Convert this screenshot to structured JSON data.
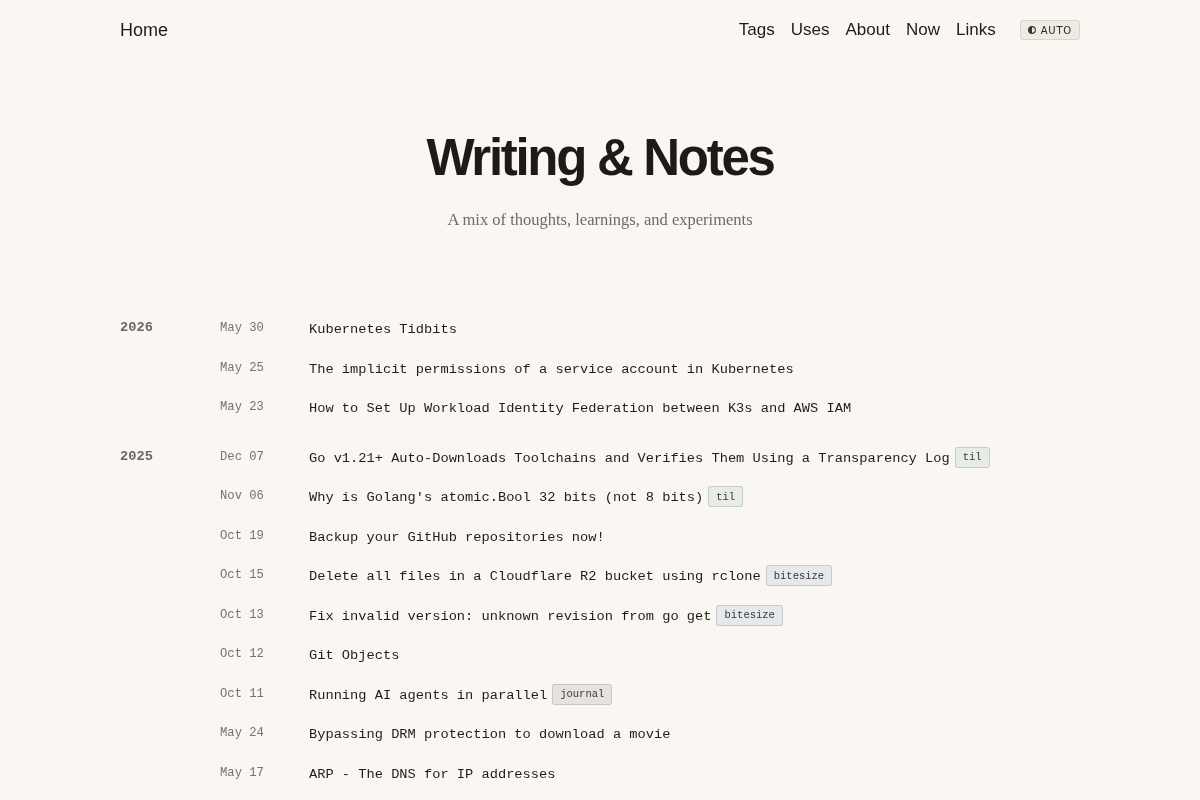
{
  "header": {
    "home": "Home",
    "nav": [
      {
        "label": "Tags"
      },
      {
        "label": "Uses"
      },
      {
        "label": "About"
      },
      {
        "label": "Now"
      },
      {
        "label": "Links"
      }
    ],
    "theme_toggle": {
      "label": "AUTO"
    }
  },
  "hero": {
    "title": "Writing & Notes",
    "subtitle": "A mix of thoughts, learnings, and experiments"
  },
  "years": [
    {
      "year": "2026",
      "posts": [
        {
          "date": "May 30",
          "title": "Kubernetes Tidbits"
        },
        {
          "date": "May 25",
          "title": "The implicit permissions of a service account in Kubernetes"
        },
        {
          "date": "May 23",
          "title": "How to Set Up Workload Identity Federation between K3s and AWS IAM"
        }
      ]
    },
    {
      "year": "2025",
      "posts": [
        {
          "date": "Dec 07",
          "title": "Go v1.21+ Auto-Downloads Toolchains and Verifies Them Using a Transparency Log",
          "tags": [
            {
              "label": "til",
              "color": "#e7ece8"
            }
          ]
        },
        {
          "date": "Nov 06",
          "title": "Why is Golang's atomic.Bool 32 bits (not 8 bits)",
          "tags": [
            {
              "label": "til",
              "color": "#e7ece8"
            }
          ]
        },
        {
          "date": "Oct 19",
          "title": "Backup your GitHub repositories now!"
        },
        {
          "date": "Oct 15",
          "title": "Delete all files in a Cloudflare R2 bucket using rclone",
          "tags": [
            {
              "label": "bitesize",
              "color": "#e6e9ec"
            }
          ]
        },
        {
          "date": "Oct 13",
          "title": "Fix invalid version: unknown revision from go get",
          "tags": [
            {
              "label": "bitesize",
              "color": "#e6e9ec"
            }
          ]
        },
        {
          "date": "Oct 12",
          "title": "Git Objects"
        },
        {
          "date": "Oct 11",
          "title": "Running AI agents in parallel",
          "tags": [
            {
              "label": "journal",
              "color": "#e6e3df"
            }
          ]
        },
        {
          "date": "May 24",
          "title": "Bypassing DRM protection to download a movie"
        },
        {
          "date": "May 17",
          "title": "ARP - The DNS for IP addresses"
        }
      ]
    }
  ]
}
